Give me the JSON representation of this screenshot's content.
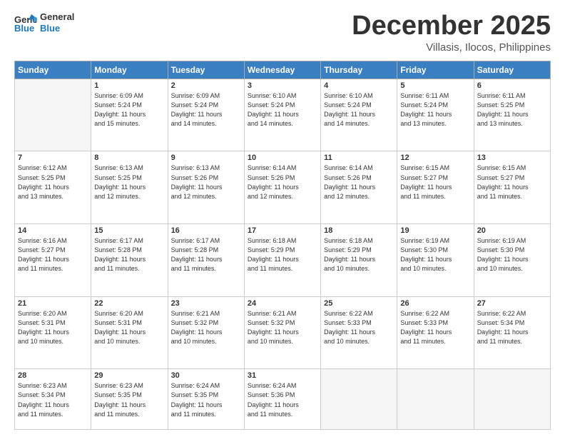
{
  "header": {
    "logo_line1": "General",
    "logo_line2": "Blue",
    "month": "December 2025",
    "location": "Villasis, Ilocos, Philippines"
  },
  "weekdays": [
    "Sunday",
    "Monday",
    "Tuesday",
    "Wednesday",
    "Thursday",
    "Friday",
    "Saturday"
  ],
  "weeks": [
    [
      {
        "num": "",
        "info": ""
      },
      {
        "num": "1",
        "info": "Sunrise: 6:09 AM\nSunset: 5:24 PM\nDaylight: 11 hours\nand 15 minutes."
      },
      {
        "num": "2",
        "info": "Sunrise: 6:09 AM\nSunset: 5:24 PM\nDaylight: 11 hours\nand 14 minutes."
      },
      {
        "num": "3",
        "info": "Sunrise: 6:10 AM\nSunset: 5:24 PM\nDaylight: 11 hours\nand 14 minutes."
      },
      {
        "num": "4",
        "info": "Sunrise: 6:10 AM\nSunset: 5:24 PM\nDaylight: 11 hours\nand 14 minutes."
      },
      {
        "num": "5",
        "info": "Sunrise: 6:11 AM\nSunset: 5:24 PM\nDaylight: 11 hours\nand 13 minutes."
      },
      {
        "num": "6",
        "info": "Sunrise: 6:11 AM\nSunset: 5:25 PM\nDaylight: 11 hours\nand 13 minutes."
      }
    ],
    [
      {
        "num": "7",
        "info": "Sunrise: 6:12 AM\nSunset: 5:25 PM\nDaylight: 11 hours\nand 13 minutes."
      },
      {
        "num": "8",
        "info": "Sunrise: 6:13 AM\nSunset: 5:25 PM\nDaylight: 11 hours\nand 12 minutes."
      },
      {
        "num": "9",
        "info": "Sunrise: 6:13 AM\nSunset: 5:26 PM\nDaylight: 11 hours\nand 12 minutes."
      },
      {
        "num": "10",
        "info": "Sunrise: 6:14 AM\nSunset: 5:26 PM\nDaylight: 11 hours\nand 12 minutes."
      },
      {
        "num": "11",
        "info": "Sunrise: 6:14 AM\nSunset: 5:26 PM\nDaylight: 11 hours\nand 12 minutes."
      },
      {
        "num": "12",
        "info": "Sunrise: 6:15 AM\nSunset: 5:27 PM\nDaylight: 11 hours\nand 11 minutes."
      },
      {
        "num": "13",
        "info": "Sunrise: 6:15 AM\nSunset: 5:27 PM\nDaylight: 11 hours\nand 11 minutes."
      }
    ],
    [
      {
        "num": "14",
        "info": "Sunrise: 6:16 AM\nSunset: 5:27 PM\nDaylight: 11 hours\nand 11 minutes."
      },
      {
        "num": "15",
        "info": "Sunrise: 6:17 AM\nSunset: 5:28 PM\nDaylight: 11 hours\nand 11 minutes."
      },
      {
        "num": "16",
        "info": "Sunrise: 6:17 AM\nSunset: 5:28 PM\nDaylight: 11 hours\nand 11 minutes."
      },
      {
        "num": "17",
        "info": "Sunrise: 6:18 AM\nSunset: 5:29 PM\nDaylight: 11 hours\nand 11 minutes."
      },
      {
        "num": "18",
        "info": "Sunrise: 6:18 AM\nSunset: 5:29 PM\nDaylight: 11 hours\nand 10 minutes."
      },
      {
        "num": "19",
        "info": "Sunrise: 6:19 AM\nSunset: 5:30 PM\nDaylight: 11 hours\nand 10 minutes."
      },
      {
        "num": "20",
        "info": "Sunrise: 6:19 AM\nSunset: 5:30 PM\nDaylight: 11 hours\nand 10 minutes."
      }
    ],
    [
      {
        "num": "21",
        "info": "Sunrise: 6:20 AM\nSunset: 5:31 PM\nDaylight: 11 hours\nand 10 minutes."
      },
      {
        "num": "22",
        "info": "Sunrise: 6:20 AM\nSunset: 5:31 PM\nDaylight: 11 hours\nand 10 minutes."
      },
      {
        "num": "23",
        "info": "Sunrise: 6:21 AM\nSunset: 5:32 PM\nDaylight: 11 hours\nand 10 minutes."
      },
      {
        "num": "24",
        "info": "Sunrise: 6:21 AM\nSunset: 5:32 PM\nDaylight: 11 hours\nand 10 minutes."
      },
      {
        "num": "25",
        "info": "Sunrise: 6:22 AM\nSunset: 5:33 PM\nDaylight: 11 hours\nand 10 minutes."
      },
      {
        "num": "26",
        "info": "Sunrise: 6:22 AM\nSunset: 5:33 PM\nDaylight: 11 hours\nand 11 minutes."
      },
      {
        "num": "27",
        "info": "Sunrise: 6:22 AM\nSunset: 5:34 PM\nDaylight: 11 hours\nand 11 minutes."
      }
    ],
    [
      {
        "num": "28",
        "info": "Sunrise: 6:23 AM\nSunset: 5:34 PM\nDaylight: 11 hours\nand 11 minutes."
      },
      {
        "num": "29",
        "info": "Sunrise: 6:23 AM\nSunset: 5:35 PM\nDaylight: 11 hours\nand 11 minutes."
      },
      {
        "num": "30",
        "info": "Sunrise: 6:24 AM\nSunset: 5:35 PM\nDaylight: 11 hours\nand 11 minutes."
      },
      {
        "num": "31",
        "info": "Sunrise: 6:24 AM\nSunset: 5:36 PM\nDaylight: 11 hours\nand 11 minutes."
      },
      {
        "num": "",
        "info": ""
      },
      {
        "num": "",
        "info": ""
      },
      {
        "num": "",
        "info": ""
      }
    ]
  ]
}
